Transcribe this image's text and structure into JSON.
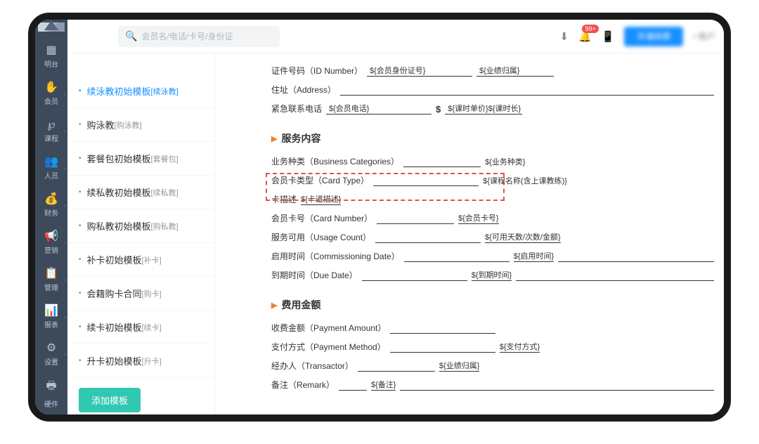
{
  "search": {
    "placeholder": "会员名/电话/卡号/身份证"
  },
  "topbar": {
    "badge": "99+",
    "blue_btn": "开通续费",
    "user": "• 账户"
  },
  "nav": [
    {
      "icon": "▦",
      "label": "明台"
    },
    {
      "icon": "✋",
      "label": "会员"
    },
    {
      "icon": "℘",
      "label": "课程"
    },
    {
      "icon": "👥",
      "label": "人员"
    },
    {
      "icon": "💰",
      "label": "财务"
    },
    {
      "icon": "📢",
      "label": "营销"
    },
    {
      "icon": "📋",
      "label": "管理"
    },
    {
      "icon": "📊",
      "label": "报表"
    },
    {
      "icon": "⚙",
      "label": "设置"
    },
    {
      "icon": "🖶",
      "label": "硬件"
    }
  ],
  "templates": [
    {
      "name": "续泳教初始模板",
      "tag": "[续泳教]",
      "active": true
    },
    {
      "name": "购泳教",
      "tag": "[购泳教]"
    },
    {
      "name": "套餐包初始模板",
      "tag": "[套餐包]"
    },
    {
      "name": "续私教初始模板",
      "tag": "[续私教]"
    },
    {
      "name": "购私教初始模板",
      "tag": "[购私教]"
    },
    {
      "name": "补卡初始模板",
      "tag": "[补卡]"
    },
    {
      "name": "会籍购卡合同",
      "tag": "[购卡]"
    },
    {
      "name": "续卡初始模板",
      "tag": "[续卡]"
    },
    {
      "name": "升卡初始模板",
      "tag": "[升卡]"
    }
  ],
  "add_template": "添加模板",
  "form": {
    "id_number_label": "证件号码（ID Number）",
    "id_number_ph": "${会员身份证号}",
    "id_belong_ph": "${业绩归属}",
    "address_label": "住址（Address）",
    "emergency_label": "紧急联系电话",
    "emergency_ph1": "${会员电话}",
    "emergency_ph2": "${课时单价}${课时长}",
    "section_service": "服务内容",
    "biz_cat_label": "业务种类（Business Categories）",
    "biz_cat_ph": "${业务种类}",
    "card_type_label": "会员卡类型（Card Type）",
    "card_type_ph": "${课程名称(含上课教练)}",
    "card_desc_label": "卡描述",
    "card_desc_ph": "${卡道描述}",
    "card_no_label": "会员卡号（Card Number）",
    "card_no_ph": "${会员卡号}",
    "usage_label": "服务可用（Usage Count）",
    "usage_ph": "${可用天数/次数/金额}",
    "commission_label": "启用时间（Commissioning Date）",
    "commission_ph": "${启用时间}",
    "due_label": "到期时间（Due Date）",
    "due_ph": "${到期时间}",
    "section_fee": "费用金额",
    "pay_amt_label": "收费金额（Payment Amount）",
    "pay_method_label": "支付方式（Payment Method）",
    "pay_method_ph": "${支付方式}",
    "transactor_label": "经办人（Transactor）",
    "transactor_ph": "${业绩归属}",
    "remark_label": "备注（Remark）",
    "remark_ph": "${备注}"
  }
}
